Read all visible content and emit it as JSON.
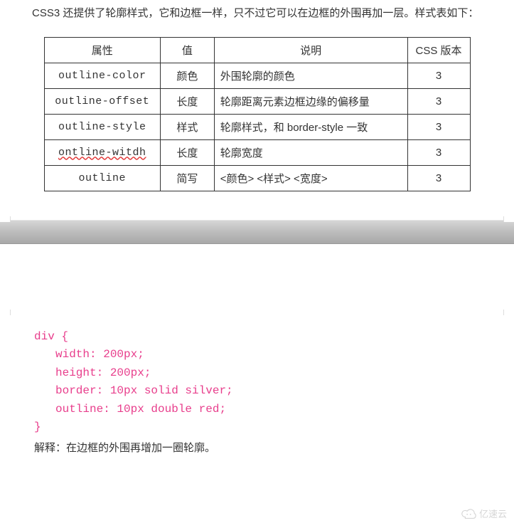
{
  "intro1": "CSS3 还提供了轮廓样式，它和边框一样，只不过它可以在边框的外围再加一层。样式表如下：",
  "table": {
    "headers": [
      "属性",
      "值",
      "说明",
      "CSS 版本"
    ],
    "rows": [
      {
        "prop": "outline-color",
        "val": "颜色",
        "desc": "外围轮廓的颜色",
        "ver": "3"
      },
      {
        "prop": "outline-offset",
        "val": "长度",
        "desc": "轮廓距离元素边框边缘的偏移量",
        "ver": "3"
      },
      {
        "prop": "outline-style",
        "val": "样式",
        "desc": "轮廓样式，和 border-style 一致",
        "ver": "3"
      },
      {
        "prop": "ontline-witdh",
        "val": "长度",
        "desc": "轮廓宽度",
        "ver": "3",
        "typo": true
      },
      {
        "prop": "outline",
        "val": "简写",
        "desc": "<颜色> <样式> <宽度>",
        "ver": "3"
      }
    ]
  },
  "code": {
    "l1": "div {",
    "l2": "width: 200px;",
    "l3": "height: 200px;",
    "l4": "border: 10px solid silver;",
    "l5": "outline: 10px double red;",
    "l6": "}"
  },
  "explain": "解释：在边框的外围再增加一圈轮廓。",
  "watermark": "亿速云"
}
